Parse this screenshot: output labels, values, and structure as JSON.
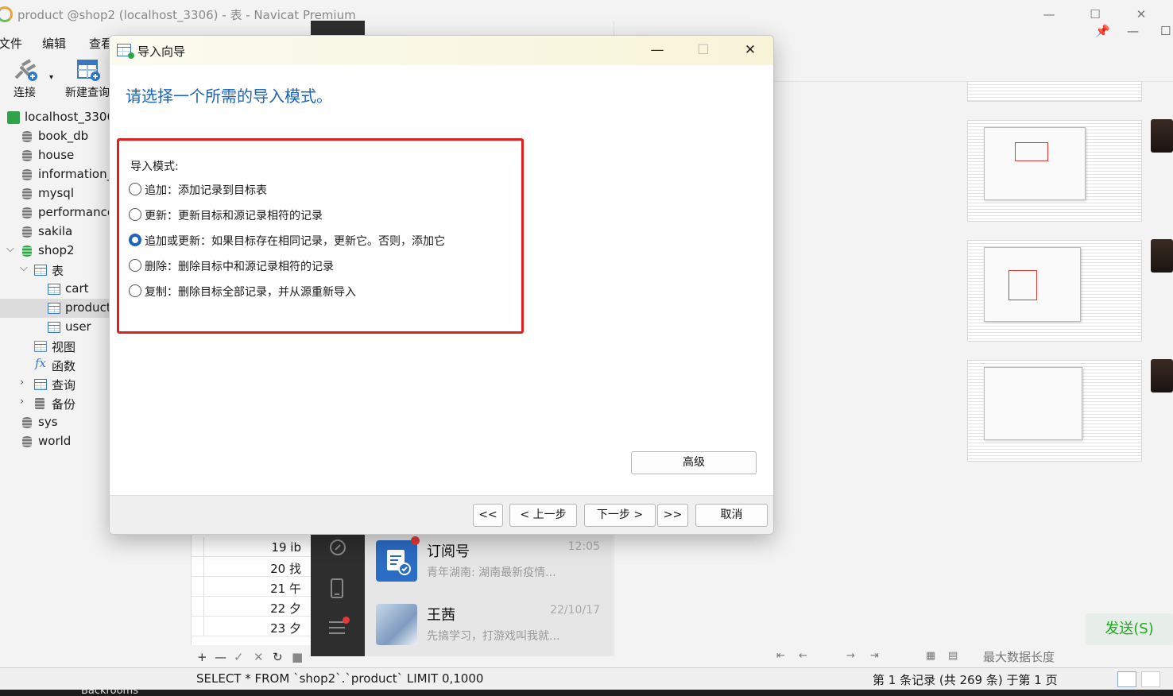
{
  "window": {
    "title": "product @shop2 (localhost_3306) - 表 - Navicat Premium",
    "controls": {
      "minimize": "—",
      "maximize": "☐",
      "close": "✕"
    }
  },
  "menu": [
    "文件",
    "编辑",
    "查看"
  ],
  "toolbar": {
    "connect_label": "连接",
    "new_query_label": "新建查询"
  },
  "tree": {
    "connection": "localhost_3306",
    "databases": [
      "book_db",
      "house",
      "information_",
      "mysql",
      "performance",
      "sakila"
    ],
    "shop2": {
      "name": "shop2",
      "tables_label": "表",
      "tables": [
        "cart",
        "product",
        "user"
      ],
      "views": "视图",
      "functions": "函数",
      "queries": "查询",
      "backups": "备份"
    },
    "more_databases": [
      "sys",
      "world"
    ]
  },
  "grid": {
    "rows": [
      {
        "num": "19",
        "text": "ib"
      },
      {
        "num": "20",
        "text": "找"
      },
      {
        "num": "21",
        "text": "午"
      },
      {
        "num": "22",
        "text": "夕"
      },
      {
        "num": "23",
        "text": "夕"
      }
    ],
    "footer_icons": [
      "+",
      "—",
      "✓",
      "✕",
      "↻",
      "■"
    ]
  },
  "chat": {
    "items": [
      {
        "name": "订阅号",
        "time": "12:05",
        "message": "青年湖南: 湖南最新疫情..."
      },
      {
        "name": "王茜",
        "time": "22/10/17",
        "message": "先搞学习，打游戏叫我就..."
      }
    ],
    "send_label": "发送(S)"
  },
  "right_panel": {
    "pin_icons": [
      "📌",
      "—",
      "☐"
    ],
    "max_length_label": "最大数据长度"
  },
  "status": {
    "sql": "SELECT * FROM `shop2`.`product` LIMIT 0,1000",
    "records": "第 1 条记录 (共 269 条) 于第 1 页"
  },
  "taskbar": {
    "item": "Backrooms"
  },
  "dialog": {
    "title": "导入向导",
    "controls": {
      "minimize": "—",
      "maximize": "☐",
      "close": "✕"
    },
    "heading": "请选择一个所需的导入模式。",
    "mode_label": "导入模式:",
    "options": [
      {
        "label": "追加：添加记录到目标表",
        "checked": false
      },
      {
        "label": "更新：更新目标和源记录相符的记录",
        "checked": false
      },
      {
        "label": "追加或更新：如果目标存在相同记录，更新它。否则，添加它",
        "checked": true
      },
      {
        "label": "删除：删除目标中和源记录相符的记录",
        "checked": false
      },
      {
        "label": "复制：删除目标全部记录，并从源重新导入",
        "checked": false
      }
    ],
    "advanced_label": "高级",
    "buttons": {
      "first": "<<",
      "prev": "< 上一步",
      "next": "下一步 >",
      "last": ">>",
      "cancel": "取消"
    }
  },
  "colors": {
    "accent": "#1f64b8",
    "highlight_box": "#e0201f",
    "send_green": "#1aad19"
  }
}
